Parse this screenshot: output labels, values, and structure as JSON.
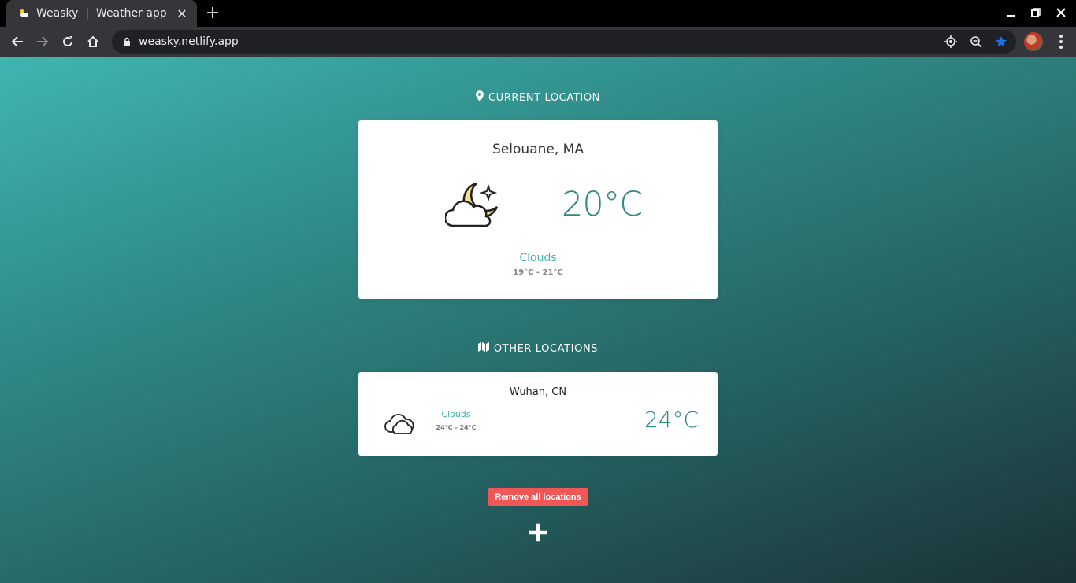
{
  "browser": {
    "tab_title": "Weasky  |  Weather app",
    "tab_close": "✕",
    "new_tab": "+",
    "url": "weasky.netlify.app"
  },
  "app": {
    "current_section": {
      "heading": "CURRENT LOCATION",
      "icon": "map-pin-icon"
    },
    "current": {
      "city": "Selouane, MA",
      "temperature": "20°C",
      "description": "Clouds",
      "range": "19°C - 21°C",
      "icon": "cloud-moon-icon"
    },
    "other_section": {
      "heading": "OTHER LOCATIONS",
      "icon": "map-icon"
    },
    "others": [
      {
        "city": "Wuhan, CN",
        "description": "Clouds",
        "range": "24°C - 24°C",
        "temperature": "24°C",
        "icon": "cloud-icon"
      }
    ],
    "remove_all_label": "Remove all locations",
    "add_icon": "plus-icon"
  },
  "colors": {
    "accent": "#2b8a86",
    "accent_light": "#3fb0aa",
    "danger": "#f25757"
  }
}
